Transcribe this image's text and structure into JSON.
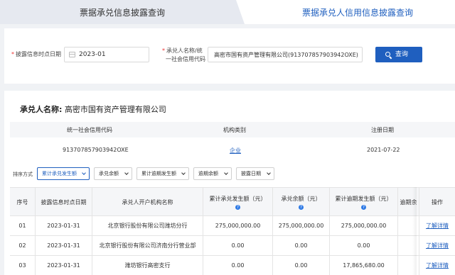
{
  "tabs": [
    {
      "label": "票据承兑信息披露查询",
      "active": false
    },
    {
      "label": "票据承兑人信用信息披露查询",
      "active": true
    }
  ],
  "search": {
    "date_label": "披露信息时点日期",
    "date_value": "2023-01",
    "name_label_line1": "承兑人名称/统",
    "name_label_line2": "一社会信用代码",
    "name_value": "高密市国有资产管理有限公司(913707857903942OXE)",
    "query_label": "查询"
  },
  "acceptor": {
    "label": "承兑人名称:",
    "name": "高密市国有资产管理有限公司"
  },
  "info_table": {
    "headers": [
      "统一社会信用代码",
      "机构类别",
      "注册日期"
    ],
    "values": [
      "913707857903942OXE",
      "企业",
      "2021-07-22"
    ]
  },
  "sort": {
    "label": "排序方式",
    "options": [
      "累计承兑发生额",
      "承兑余额",
      "累计逾期发生额",
      "逾期余额",
      "披露日期"
    ],
    "active_index": 0
  },
  "table": {
    "columns": [
      "序号",
      "披露信息时点日期",
      "承兑人开户机构名称",
      "累计承兑发生额（元）",
      "承兑余额（元）",
      "累计逾期发生额（元）",
      "逾期余",
      "操作"
    ],
    "rows": [
      {
        "no": "01",
        "date": "2023-01-31",
        "bank": "北京银行股份有限公司潍坊分行",
        "cum_accept": "275,000,000.00",
        "balance": "275,000,000.00",
        "cum_overdue": "275,000,000.00",
        "overdue_bal": "",
        "op": "了解详情"
      },
      {
        "no": "02",
        "date": "2023-01-31",
        "bank": "北京银行股份有限公司济南分行营业部",
        "cum_accept": "0.00",
        "balance": "0.00",
        "cum_overdue": "0.00",
        "overdue_bal": "",
        "op": "了解详情"
      },
      {
        "no": "03",
        "date": "2023-01-31",
        "bank": "潍坊银行高密支行",
        "cum_accept": "0.00",
        "balance": "0.00",
        "cum_overdue": "17,865,680.00",
        "overdue_bal": "",
        "op": "了解详情"
      }
    ]
  },
  "colors": {
    "accent": "#1f5fbf",
    "page_bg": "#f0f2f5",
    "header_bg": "#f5f6f8"
  }
}
